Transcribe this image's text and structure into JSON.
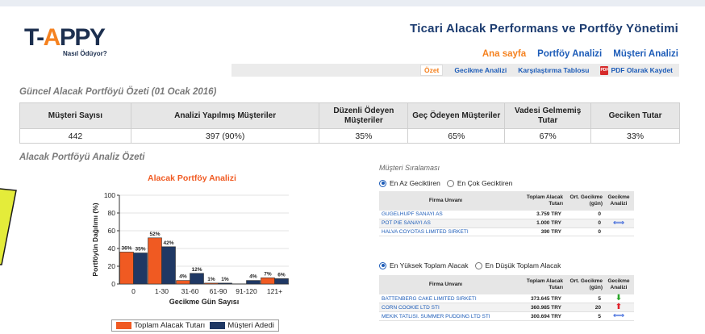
{
  "logo": {
    "text_main": "T-",
    "text_accent": "A",
    "text_rest": "PPY",
    "subtitle": "Nasıl Ödüyor?"
  },
  "app_title": "Ticari Alacak Performans ve Portföy Yönetimi",
  "main_nav": [
    {
      "label": "Ana sayfa",
      "active": true
    },
    {
      "label": "Portföy Analizi",
      "active": false
    },
    {
      "label": "Müşteri Analizi",
      "active": false
    }
  ],
  "sub_nav": [
    {
      "label": "Özet",
      "active": true
    },
    {
      "label": "Gecikme Analizi",
      "active": false
    },
    {
      "label": "Karşılaştırma Tablosu",
      "active": false
    },
    {
      "label": "PDF Olarak Kaydet",
      "active": false,
      "icon": "pdf-icon"
    }
  ],
  "summary": {
    "title": "Güncel Alacak Portföyü Özeti (01 Ocak 2016)",
    "headers": [
      "Müşteri Sayısı",
      "Analizi Yapılmış Müşteriler",
      "Düzenli Ödeyen Müşteriler",
      "Geç Ödeyen Müşteriler",
      "Vadesi Gelmemiş Tutar",
      "Geciken Tutar"
    ],
    "values": [
      "442",
      "397 (90%)",
      "35%",
      "65%",
      "67%",
      "33%"
    ]
  },
  "analysis_title": "Alacak Portföyü Analiz Özeti",
  "chart_data": {
    "type": "bar",
    "title": "Alacak Portföy Analizi",
    "xlabel": "Gecikme Gün Sayısı",
    "ylabel": "Portföyün Dağılımı (%)",
    "ylim": [
      0,
      100
    ],
    "yticks": [
      0,
      20,
      40,
      60,
      80,
      100
    ],
    "categories": [
      "0",
      "1-30",
      "31-60",
      "61-90",
      "91-120",
      "121+"
    ],
    "series": [
      {
        "name": "Toplam Alacak Tutarı",
        "color": "#f05a22",
        "values": [
          36,
          52,
          4,
          1,
          0,
          7
        ],
        "labels": [
          "36%",
          "52%",
          "4%",
          "1%",
          "",
          "7%"
        ]
      },
      {
        "name": "Müşteri Adedi",
        "color": "#1f3864",
        "values": [
          35,
          42,
          12,
          1,
          4,
          6
        ],
        "labels": [
          "35%",
          "42%",
          "12%",
          "1%",
          "4%",
          "6%"
        ]
      }
    ],
    "grid": true,
    "legend": "bottom"
  },
  "ranking": {
    "title": "Müşteri Sıralaması",
    "radio_group1": [
      {
        "label": "En Az Geciktiren",
        "checked": true
      },
      {
        "label": "En Çok Geciktiren",
        "checked": false
      }
    ],
    "radio_group2": [
      {
        "label": "En Yüksek Toplam Alacak",
        "checked": true
      },
      {
        "label": "En Düşük Toplam Alacak",
        "checked": false
      }
    ],
    "headers": {
      "firm": "Firma Unvanı",
      "total": "Toplam Alacak Tutarı",
      "avg_delay": "Ort. Gecikme (gün)",
      "delay_analysis": "Gecikme Analizi"
    },
    "table1": [
      {
        "firm": "GUGELHUPF SANAYI AS",
        "total": "3.759 TRY",
        "avg": "0",
        "icon": ""
      },
      {
        "firm": "POT PIE SANAYI AS",
        "total": "1.000 TRY",
        "avg": "0",
        "icon": "left-right-arrow-icon"
      },
      {
        "firm": "HALVA COYOTAS LIMITED SIRKETI",
        "total": "390 TRY",
        "avg": "0",
        "icon": ""
      }
    ],
    "table2": [
      {
        "firm": "BATTENBERG CAKE LIMITED SIRKETI",
        "total": "373.645 TRY",
        "avg": "5",
        "icon": "down-arrow-icon"
      },
      {
        "firm": "CORN COOKIE LTD STI",
        "total": "360.985 TRY",
        "avg": "20",
        "icon": "up-arrow-icon"
      },
      {
        "firm": "MEKIK TATLISI. SUMMER PUDDING LTD STI",
        "total": "300.694 TRY",
        "avg": "5",
        "icon": "left-right-arrow-icon"
      }
    ]
  }
}
